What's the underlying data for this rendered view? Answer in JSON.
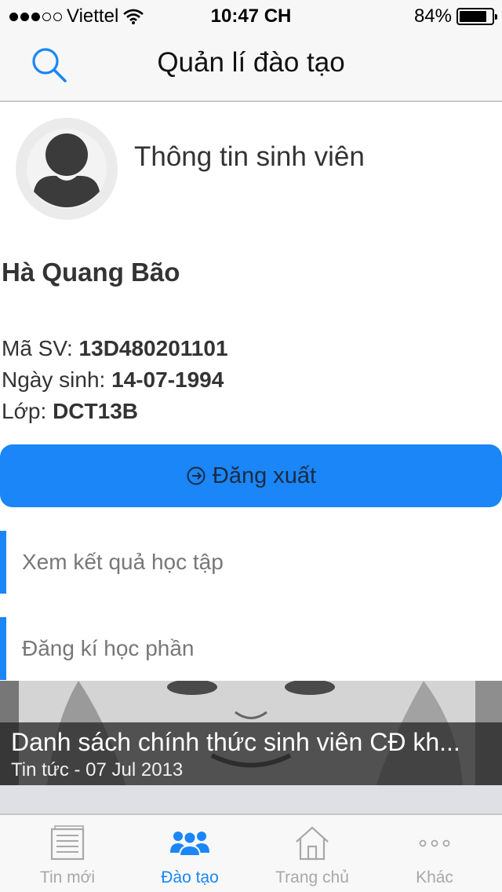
{
  "status_bar": {
    "carrier": "Viettel",
    "time": "10:47 CH",
    "battery": "84%",
    "battery_level": 0.84
  },
  "nav": {
    "title": "Quản lí đào tạo"
  },
  "profile": {
    "heading": "Thông tin sinh viên",
    "name": "Hà Quang Bão",
    "student_id_label": "Mã SV: ",
    "student_id": "13D480201101",
    "dob_label": "Ngày sinh: ",
    "dob": "14-07-1994",
    "class_label": "Lớp: ",
    "class": "DCT13B"
  },
  "actions": {
    "logout": "Đăng xuất"
  },
  "menu": [
    {
      "label": "Xem kết quả học tập"
    },
    {
      "label": "Đăng kí học phần"
    }
  ],
  "news": {
    "title": "Danh sách chính thức sinh viên CĐ kh...",
    "meta": "Tin tức - 07 Jul 2013"
  },
  "tabs": [
    {
      "label": "Tin mới",
      "icon": "newspaper-icon"
    },
    {
      "label": "Đào tạo",
      "icon": "people-icon"
    },
    {
      "label": "Trang chủ",
      "icon": "home-icon"
    },
    {
      "label": "Khác",
      "icon": "more-icon"
    }
  ],
  "colors": {
    "accent": "#1a86f7",
    "tab_inactive": "#a8a8a8"
  }
}
